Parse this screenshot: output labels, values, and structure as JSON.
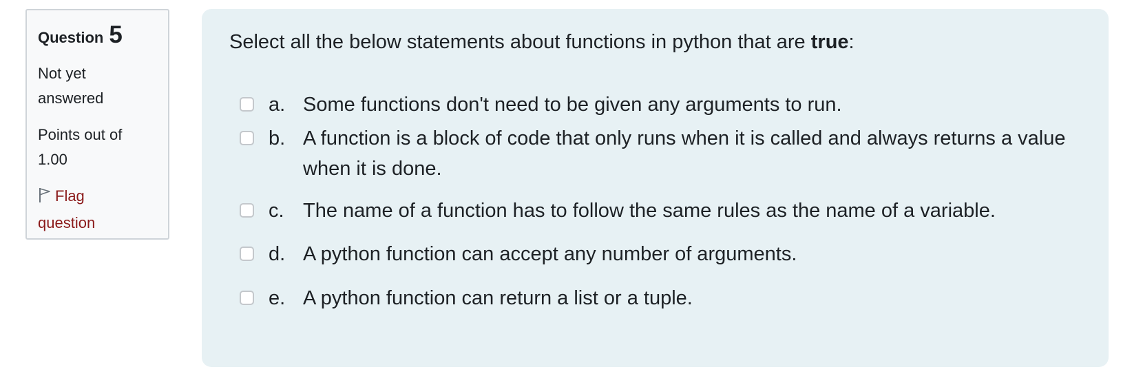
{
  "info": {
    "question_word": "Question",
    "question_number": "5",
    "state": "Not yet answered",
    "grade": "Points out of 1.00",
    "flag_label": "Flag question"
  },
  "question": {
    "prefix": "Select all the below statements about functions in python that are ",
    "emphasis": "true",
    "suffix": ":",
    "answers": [
      {
        "letter": "a.",
        "text": "Some functions don't need to be given any arguments to run.",
        "checked": false
      },
      {
        "letter": "b.",
        "text": "A function is a block of code that only runs when it is called and always returns a value when it is done.",
        "checked": false
      },
      {
        "letter": "c.",
        "text": "The name of a function has to follow the same rules as the name of a variable.",
        "checked": false
      },
      {
        "letter": "d.",
        "text": "A python function can accept any number of arguments.",
        "checked": false
      },
      {
        "letter": "e.",
        "text": "A python function can return a list or a tuple.",
        "checked": false
      }
    ]
  },
  "colors": {
    "info_bg": "#f8f9fa",
    "content_bg": "#e7f1f4",
    "flag_link": "#8b1a1a",
    "text": "#1d2125"
  }
}
